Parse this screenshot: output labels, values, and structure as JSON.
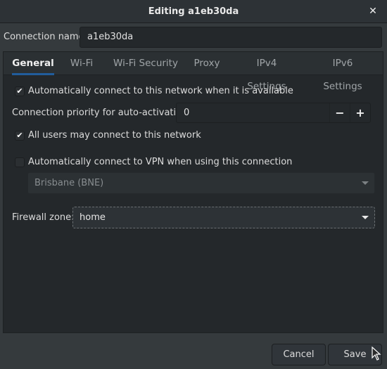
{
  "window": {
    "title": "Editing a1eb30da",
    "close_icon": "close-icon"
  },
  "connection": {
    "label": "Connection name:",
    "value": "a1eb30da"
  },
  "tabs": [
    {
      "label": "General",
      "active": true
    },
    {
      "label": "Wi-Fi",
      "active": false
    },
    {
      "label": "Wi-Fi Security",
      "active": false
    },
    {
      "label": "Proxy",
      "active": false
    },
    {
      "label": "IPv4 Settings",
      "active": false
    },
    {
      "label": "IPv6 Settings",
      "active": false
    }
  ],
  "general": {
    "auto_connect": {
      "label": "Automatically connect to this network when it is available",
      "checked": true,
      "glyph": "✔"
    },
    "priority": {
      "label": "Connection priority for auto-activation:",
      "value": "0",
      "minus": "−",
      "plus": "+"
    },
    "all_users": {
      "label": "All users may connect to this network",
      "checked": true,
      "glyph": "✔"
    },
    "vpn": {
      "label": "Automatically connect to VPN when using this connection",
      "checked": false,
      "glyph": ""
    },
    "vpn_select": {
      "value": "Brisbane (BNE)",
      "disabled": true
    },
    "firewall": {
      "label": "Firewall zone:",
      "value": "home"
    }
  },
  "buttons": {
    "cancel": "Cancel",
    "save": "Save"
  },
  "colors": {
    "accent": "#215d9c",
    "background": "#353a3d",
    "panel": "#24282b"
  }
}
